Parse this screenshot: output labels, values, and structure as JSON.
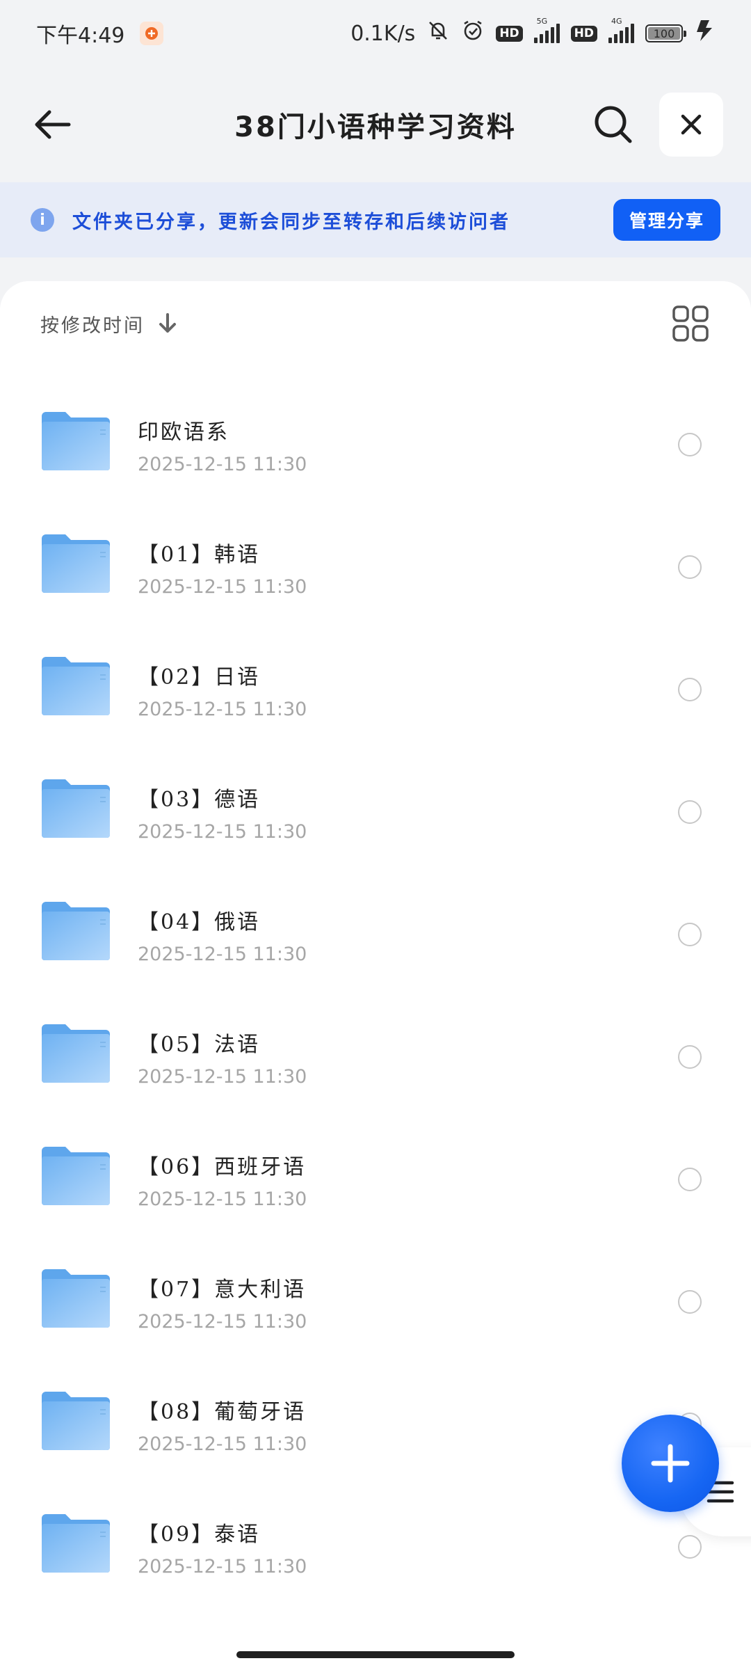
{
  "status_bar": {
    "time": "下午4:49",
    "net_speed": "0.1K/s",
    "hd_label": "HD",
    "network_5g": "5G",
    "network_4g": "4G",
    "battery": "100",
    "icons": [
      "app-notification-icon",
      "bell-muted-icon",
      "alarm-icon",
      "hd-icon",
      "signal-5g-icon",
      "hd-icon",
      "signal-4g-icon",
      "battery-icon",
      "charging-icon"
    ]
  },
  "header": {
    "title": "38门小语种学习资料",
    "back_icon": "arrow-left-icon",
    "search_icon": "search-icon",
    "close_icon": "close-icon"
  },
  "share_banner": {
    "message": "文件夹已分享，更新会同步至转存和后续访问者",
    "button": "管理分享",
    "icon": "info-icon",
    "accent_color": "#1160f5"
  },
  "sort": {
    "label": "按修改时间",
    "direction_icon": "arrow-down-icon",
    "view_toggle_icon": "grid-view-icon"
  },
  "files": [
    {
      "name": "",
      "date": "2025-12-15  11:30"
    },
    {
      "name": "印欧语系",
      "date": "2025-12-15  11:30"
    },
    {
      "name": "【01】韩语",
      "date": "2025-12-15  11:30"
    },
    {
      "name": "【02】日语",
      "date": "2025-12-15  11:30"
    },
    {
      "name": "【03】德语",
      "date": "2025-12-15  11:30"
    },
    {
      "name": "【04】俄语",
      "date": "2025-12-15  11:30"
    },
    {
      "name": "【05】法语",
      "date": "2025-12-15  11:30"
    },
    {
      "name": "【06】西班牙语",
      "date": "2025-12-15  11:30"
    },
    {
      "name": "【07】意大利语",
      "date": "2025-12-15  11:30"
    },
    {
      "name": "【08】葡萄牙语",
      "date": "2025-12-15  11:30"
    },
    {
      "name": "【09】泰语",
      "date": "2025-12-15  11:30"
    }
  ],
  "fab": {
    "icon": "plus-icon"
  },
  "side_handle": {
    "icon": "menu-icon"
  }
}
